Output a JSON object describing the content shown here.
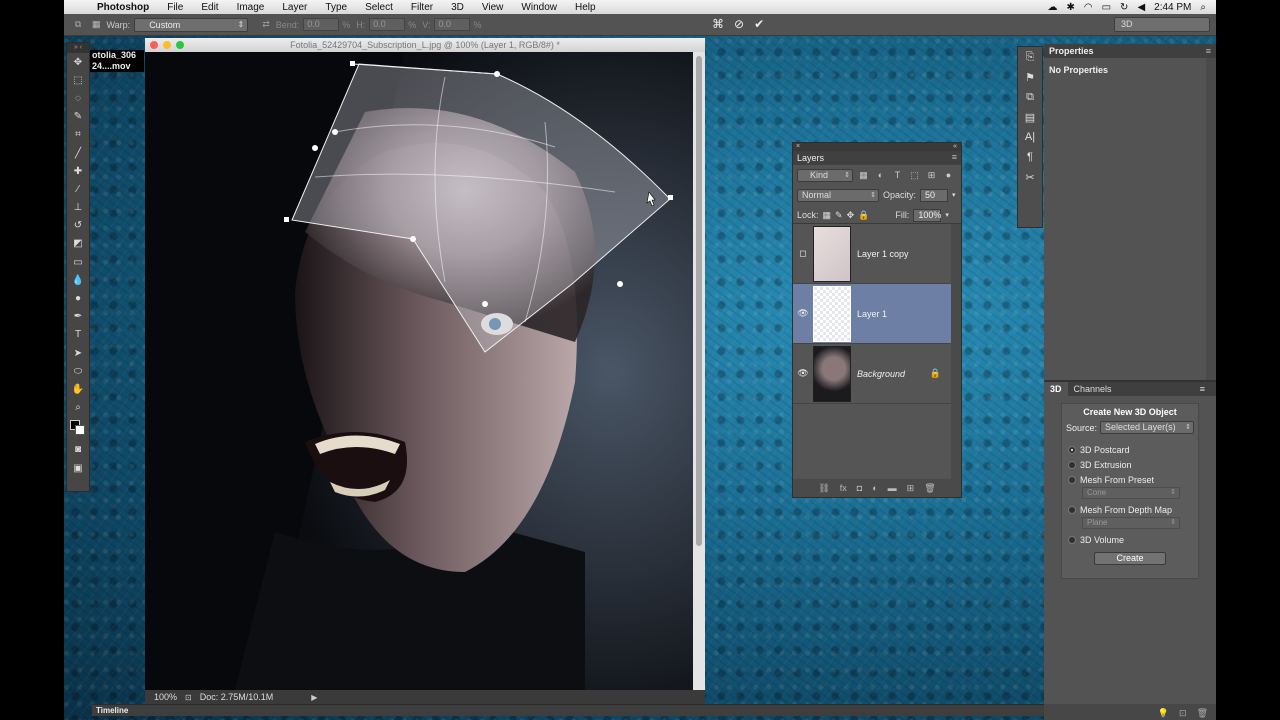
{
  "menubar": {
    "app_name": "Photoshop",
    "items": [
      "File",
      "Edit",
      "Image",
      "Layer",
      "Type",
      "Select",
      "Filter",
      "3D",
      "View",
      "Window",
      "Help"
    ],
    "clock": "2:44 PM"
  },
  "options": {
    "warp_label": "Warp:",
    "warp_value": "Custom",
    "bend_label": "Bend:",
    "bend_value": "0.0",
    "bend_unit": "%",
    "h_label": "H:",
    "h_value": "0.0",
    "h_unit": "%",
    "v_label": "V:",
    "v_value": "0.0",
    "v_unit": "%",
    "workspace": "3D"
  },
  "doc_tab": {
    "line1": "otolia_306",
    "line2": "24....mov"
  },
  "document": {
    "title": "Fotolia_52429704_Subscription_L.jpg @ 100% (Layer 1, RGB/8#) *",
    "zoom": "100%",
    "doc_info": "Doc: 2.75M/10.1M"
  },
  "layers": {
    "tab": "Layers",
    "filter_kind": "Kind",
    "blend_mode": "Normal",
    "opacity_label": "Opacity:",
    "opacity_value": "50",
    "lock_label": "Lock:",
    "fill_label": "Fill:",
    "fill_value": "100%",
    "items": [
      {
        "name": "Layer 1 copy",
        "visible": false,
        "selected": false
      },
      {
        "name": "Layer 1",
        "visible": true,
        "selected": true
      },
      {
        "name": "Background",
        "visible": true,
        "selected": false,
        "locked": true
      }
    ]
  },
  "properties": {
    "title": "Properties",
    "body": "No Properties"
  },
  "threed": {
    "tab_3d": "3D",
    "tab_channels": "Channels",
    "title": "Create New 3D Object",
    "source_label": "Source:",
    "source_value": "Selected Layer(s)",
    "options": [
      {
        "label": "3D Postcard",
        "checked": true
      },
      {
        "label": "3D Extrusion",
        "checked": false
      },
      {
        "label": "Mesh From Preset",
        "checked": false
      },
      {
        "label": "Mesh From Depth Map",
        "checked": false
      },
      {
        "label": "3D Volume",
        "checked": false
      }
    ],
    "preset_value": "Cone",
    "depth_value": "Plane",
    "create_label": "Create"
  },
  "timeline": {
    "label": "Timeline"
  },
  "colors": {
    "accent_selected": "#6e7fa6",
    "desktop": "#1b6f95",
    "panel": "#535353"
  }
}
